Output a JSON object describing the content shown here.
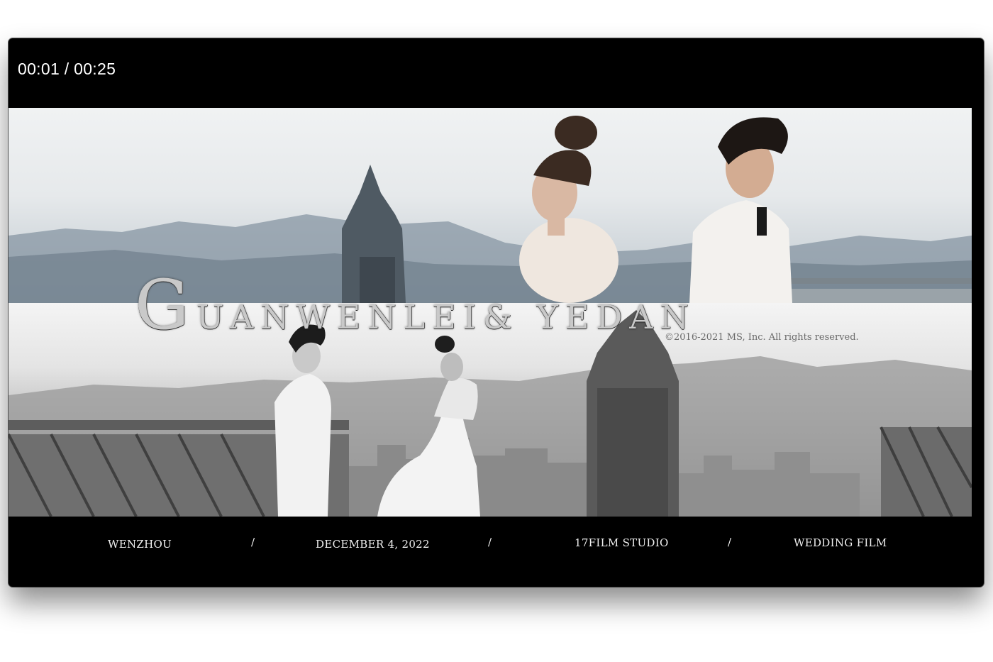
{
  "player": {
    "timecode": "00:01 / 00:25"
  },
  "video_frame": {
    "title_initial": "G",
    "title_rest": "UANWENLEI& YEDAN",
    "copyright": "©2016-2021 MS, Inc. All rights reserved."
  },
  "footer": {
    "items": [
      "WENZHOU",
      "DECEMBER 4, 2022",
      "17FILM STUDIO",
      "WEDDING FILM"
    ],
    "separator": "/"
  },
  "colors": {
    "background": "#000000",
    "text": "#ffffff"
  }
}
